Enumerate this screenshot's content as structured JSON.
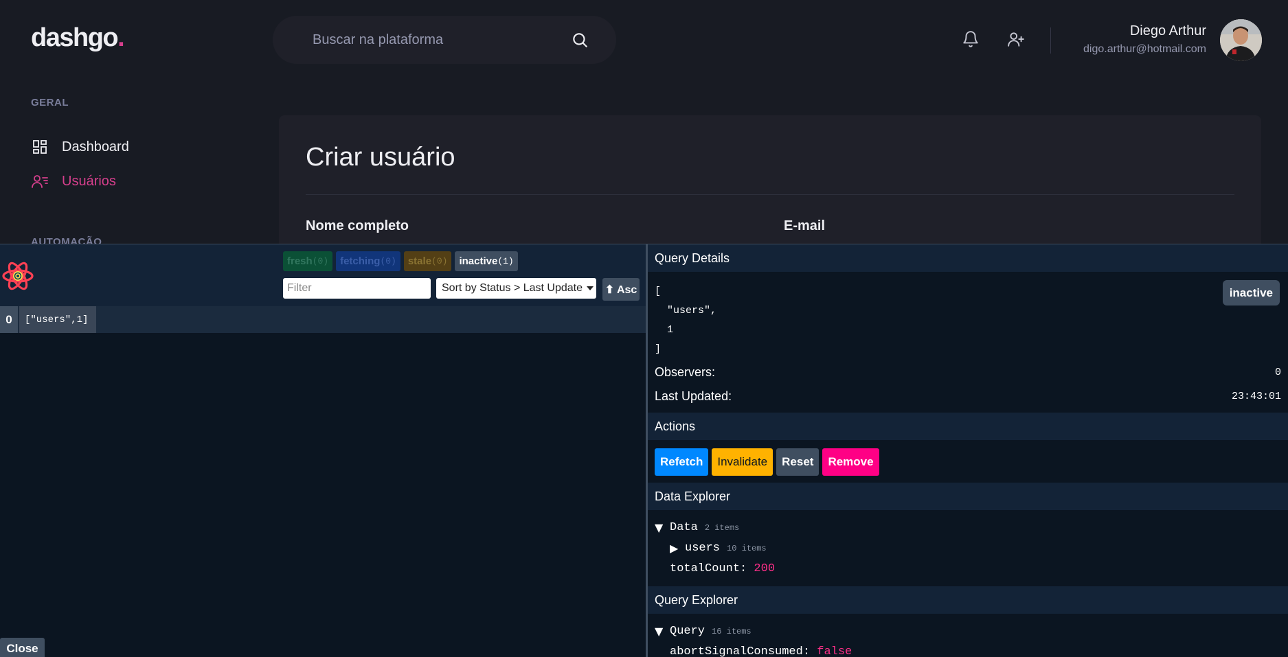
{
  "app": {
    "logo_text": "dashgo",
    "logo_dot": ".",
    "search": {
      "placeholder": "Buscar na plataforma"
    },
    "user": {
      "name": "Diego Arthur",
      "email": "digo.arthur@hotmail.com"
    },
    "sidebar": {
      "section_general": "GERAL",
      "items": [
        {
          "label": "Dashboard",
          "icon": "dashboard-icon",
          "active": false
        },
        {
          "label": "Usuários",
          "icon": "users-icon",
          "active": true
        }
      ],
      "section_automation": "AUTOMAÇÃO"
    },
    "main": {
      "title": "Criar usuário",
      "field_name_label": "Nome completo",
      "field_email_label": "E-mail"
    },
    "colors": {
      "background": "#181b23",
      "card": "#1f2029",
      "accent": "#d53f8c",
      "muted": "#9699b0"
    }
  },
  "devtools": {
    "badges": [
      {
        "label": "fresh",
        "count": "(0)"
      },
      {
        "label": "fetching",
        "count": "(0)"
      },
      {
        "label": "stale",
        "count": "(0)"
      },
      {
        "label": "inactive",
        "count": "(1)"
      }
    ],
    "filter_placeholder": "Filter",
    "sort_label": "Sort by Status > Last Update",
    "asc_label": "⬆ Asc",
    "queries": [
      {
        "observers": "0",
        "key": "[\"users\",1]"
      }
    ],
    "close_label": "Close",
    "details": {
      "header": "Query Details",
      "key_lines": [
        "[",
        "  \"users\",",
        "  1",
        "]"
      ],
      "status": "inactive",
      "observers_label": "Observers:",
      "observers_value": "0",
      "last_updated_label": "Last Updated:",
      "last_updated_value": "23:43:01"
    },
    "actions": {
      "header": "Actions",
      "refetch": "Refetch",
      "invalidate": "Invalidate",
      "reset": "Reset",
      "remove": "Remove"
    },
    "data_explorer": {
      "header": "Data Explorer",
      "root_label": "Data",
      "root_info": "2 items",
      "users_label": "users",
      "users_info": "10 items",
      "total_label": "totalCount:",
      "total_value": "200"
    },
    "query_explorer": {
      "header": "Query Explorer",
      "root_label": "Query",
      "root_info": "16 items",
      "first_label": "abortSignalConsumed:",
      "first_value": "false"
    },
    "colors": {
      "background": "#0b1521",
      "panel": "#132337",
      "fresh": "#00ab52",
      "fetching": "#0088ff",
      "stale": "#ffb200",
      "inactive": "#3f4e60",
      "remove": "#ff0085"
    }
  }
}
